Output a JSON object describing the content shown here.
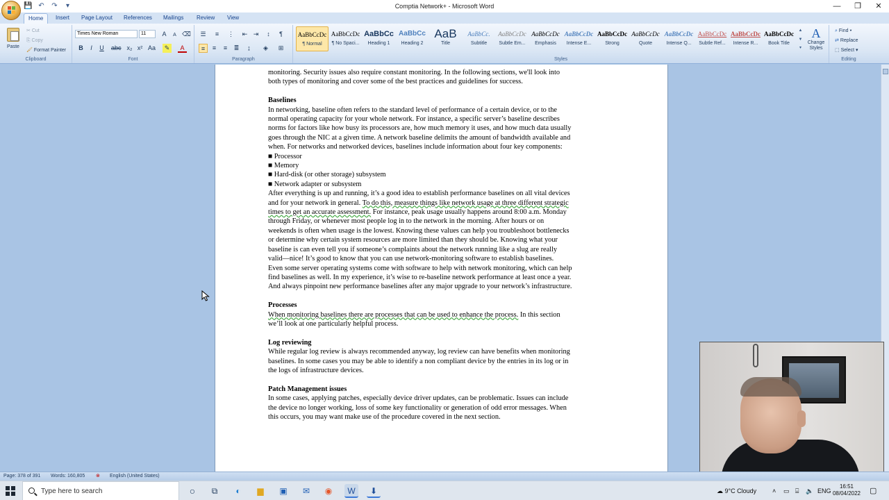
{
  "window": {
    "title": "Comptia Network+ - Microsoft Word",
    "minimize": "—",
    "maximize": "❐",
    "close": "✕"
  },
  "quick_access": [
    "💾",
    "↶",
    "↷",
    "▾"
  ],
  "ribbon_tabs": [
    "Home",
    "Insert",
    "Page Layout",
    "References",
    "Mailings",
    "Review",
    "View"
  ],
  "clipboard": {
    "paste": "Paste",
    "cut": "Cut",
    "copy": "Copy",
    "format_painter": "Format Painter",
    "group_label": "Clipboard"
  },
  "font": {
    "name": "Times New Roman",
    "size": "11",
    "group_label": "Font"
  },
  "paragraph": {
    "group_label": "Paragraph"
  },
  "styles": {
    "group_label": "Styles",
    "items": [
      {
        "sample": "AaBbCcDc",
        "name": "¶ Normal"
      },
      {
        "sample": "AaBbCcDc",
        "name": "¶ No Spaci..."
      },
      {
        "sample": "AaBbCc",
        "name": "Heading 1"
      },
      {
        "sample": "AaBbCc",
        "name": "Heading 2"
      },
      {
        "sample": "AaB",
        "name": "Title"
      },
      {
        "sample": "AaBbCc.",
        "name": "Subtitle"
      },
      {
        "sample": "AaBbCcDc",
        "name": "Subtle Em..."
      },
      {
        "sample": "AaBbCcDc",
        "name": "Emphasis"
      },
      {
        "sample": "AaBbCcDc",
        "name": "Intense E..."
      },
      {
        "sample": "AaBbCcDc",
        "name": "Strong"
      },
      {
        "sample": "AaBbCcDc",
        "name": "Quote"
      },
      {
        "sample": "AaBbCcDc",
        "name": "Intense Q..."
      },
      {
        "sample": "AaBbCcDc",
        "name": "Subtle Ref..."
      },
      {
        "sample": "AaBbCcDc",
        "name": "Intense R..."
      },
      {
        "sample": "AaBbCcDc",
        "name": "Book Title"
      }
    ],
    "change_styles": "Change Styles"
  },
  "editing": {
    "group_label": "Editing",
    "find": "Find",
    "replace": "Replace",
    "select": "Select"
  },
  "document": {
    "lead_lines": [
      "monitoring. Security issues also require constant monitoring. In the following sections, we'll look into",
      "both types of monitoring and cover some of the best practices and guidelines for success."
    ],
    "baselines_heading": "Baselines",
    "baselines_lines": [
      "In networking, baseline often refers to the standard level of performance of a certain device, or to the",
      "normal operating capacity for your whole network. For instance, a specific server’s baseline describes",
      "norms for factors like how busy its processors are, how much memory it uses, and how much data usually",
      "goes through the NIC at a given time. A network baseline delimits the amount of bandwidth available and",
      "when. For networks and networked devices, baselines include information about four key components:"
    ],
    "components": [
      "Processor",
      "Memory",
      "Hard-disk (or other storage) subsystem",
      "Network adapter or subsystem"
    ],
    "after_lines_1": "After everything is up and running, it’s a good idea to establish performance baselines on all vital devices",
    "after_line_2a": "and for your network in general. ",
    "after_line_2b": "To do this, measure things like network usage at three different strategic",
    "after_line_3a": "times to get an accurate assessment.",
    "after_line_3b": " For instance, peak usage usually happens around 8:00 a.m. Monday",
    "after_lines_rest": [
      "through Friday, or whenever most people log in to the network in the morning. After hours or on",
      "weekends is often when usage is the lowest. Knowing these values can help you troubleshoot bottlenecks",
      "or determine why certain system resources are more limited than they should be. Knowing what your",
      "baseline is can even tell you if someone’s complaints about the network running like a slug are really",
      "valid—nice! It’s good to know that you can use network-monitoring software to establish baselines.",
      "Even some server operating systems come with software to help with network monitoring, which can help",
      "find baselines as well. In my experience, it’s wise to re-baseline network performance at least once a year.",
      "And always pinpoint new performance baselines after any major upgrade to your network’s infrastructure."
    ],
    "processes_heading": "Processes",
    "processes_line_1a": "When monitoring baselines there are processes that can be used to enhance the process.",
    "processes_line_1b": " In this section",
    "processes_line_2": "we’ll look at one particularly helpful process.",
    "log_heading": "Log reviewing",
    "log_lines": [
      "While regular log review is always recommended anyway, log review can have benefits when monitoring",
      "baselines. In some cases you may be able to identify a non compliant device by the entries in its log or in",
      "the logs of infrastructure devices."
    ],
    "patch_heading": "Patch Management issues",
    "patch_lines": [
      "In some cases, applying patches, especially device driver updates, can be problematic. Issues can include",
      "the device no longer working, loss of some key functionality or generation of odd error messages. When",
      "this occurs, you may want make use of the procedure covered in the next section."
    ]
  },
  "status_bar": {
    "page": "Page: 378 of 391",
    "words": "Words: 160,805",
    "language": "English (United States)"
  },
  "taskbar": {
    "search_placeholder": "Type here to search",
    "weather": "9°C  Cloudy",
    "language": "ENG",
    "time": "16:51",
    "date": "08/04/2022"
  },
  "colors": {
    "ribbon_bg": "#dae6f4",
    "doc_bg": "#a9c4e4",
    "grammar_underline": "#3aa63a",
    "selected_style": "#fde7a8"
  }
}
